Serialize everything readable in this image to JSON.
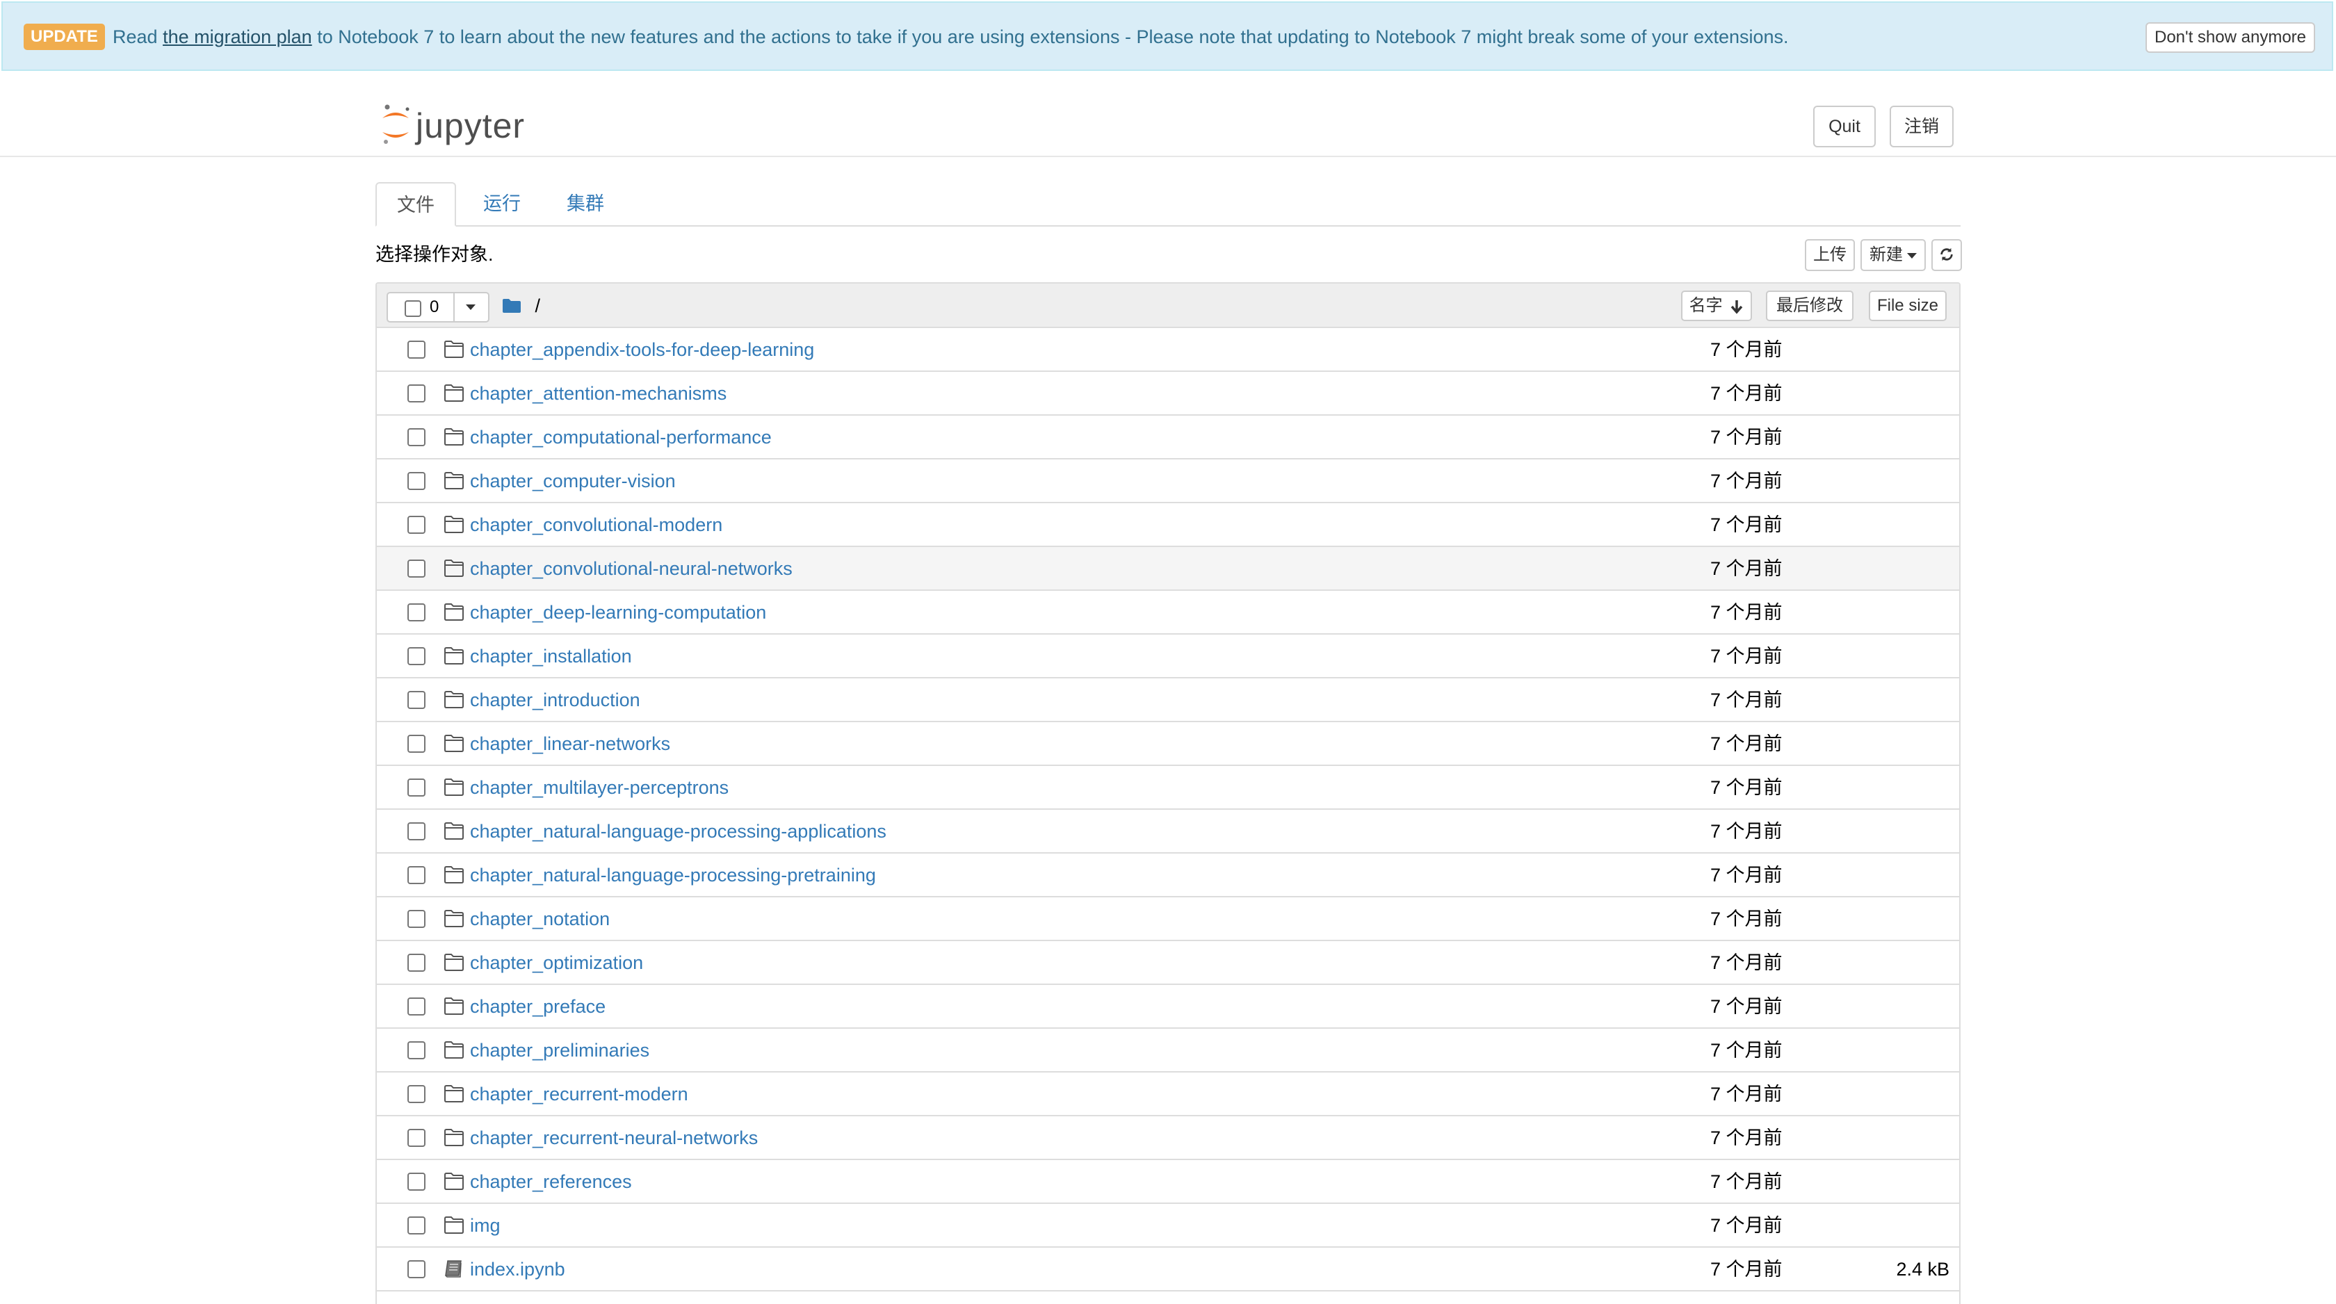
{
  "banner": {
    "badge": "UPDATE",
    "text_before": "Read ",
    "link": "the migration plan",
    "text_after": " to Notebook 7 to learn about the new features and the actions to take if you are using extensions - Please note that updating to Notebook 7 might break some of your extensions.",
    "dismiss_label": "Don't show anymore"
  },
  "header": {
    "logo_text": "jupyter",
    "quit_label": "Quit",
    "logout_label": "注销"
  },
  "tabs": [
    {
      "label": "文件",
      "active": true
    },
    {
      "label": "运行",
      "active": false
    },
    {
      "label": "集群",
      "active": false
    }
  ],
  "toolbar": {
    "select_hint": "选择操作对象.",
    "upload_label": "上传",
    "new_label": "新建",
    "refresh_icon": "refresh-icon"
  },
  "list_header": {
    "selected_count": "0",
    "breadcrumb": "/",
    "sort_name_label": "名字",
    "sort_modified_label": "最后修改",
    "sort_size_label": "File size"
  },
  "items": [
    {
      "name": "chapter_appendix-tools-for-deep-learning",
      "type": "folder",
      "modified": "7 个月前",
      "size": ""
    },
    {
      "name": "chapter_attention-mechanisms",
      "type": "folder",
      "modified": "7 个月前",
      "size": ""
    },
    {
      "name": "chapter_computational-performance",
      "type": "folder",
      "modified": "7 个月前",
      "size": ""
    },
    {
      "name": "chapter_computer-vision",
      "type": "folder",
      "modified": "7 个月前",
      "size": ""
    },
    {
      "name": "chapter_convolutional-modern",
      "type": "folder",
      "modified": "7 个月前",
      "size": ""
    },
    {
      "name": "chapter_convolutional-neural-networks",
      "type": "folder",
      "modified": "7 个月前",
      "size": ""
    },
    {
      "name": "chapter_deep-learning-computation",
      "type": "folder",
      "modified": "7 个月前",
      "size": ""
    },
    {
      "name": "chapter_installation",
      "type": "folder",
      "modified": "7 个月前",
      "size": ""
    },
    {
      "name": "chapter_introduction",
      "type": "folder",
      "modified": "7 个月前",
      "size": ""
    },
    {
      "name": "chapter_linear-networks",
      "type": "folder",
      "modified": "7 个月前",
      "size": ""
    },
    {
      "name": "chapter_multilayer-perceptrons",
      "type": "folder",
      "modified": "7 个月前",
      "size": ""
    },
    {
      "name": "chapter_natural-language-processing-applications",
      "type": "folder",
      "modified": "7 个月前",
      "size": ""
    },
    {
      "name": "chapter_natural-language-processing-pretraining",
      "type": "folder",
      "modified": "7 个月前",
      "size": ""
    },
    {
      "name": "chapter_notation",
      "type": "folder",
      "modified": "7 个月前",
      "size": ""
    },
    {
      "name": "chapter_optimization",
      "type": "folder",
      "modified": "7 个月前",
      "size": ""
    },
    {
      "name": "chapter_preface",
      "type": "folder",
      "modified": "7 个月前",
      "size": ""
    },
    {
      "name": "chapter_preliminaries",
      "type": "folder",
      "modified": "7 个月前",
      "size": ""
    },
    {
      "name": "chapter_recurrent-modern",
      "type": "folder",
      "modified": "7 个月前",
      "size": ""
    },
    {
      "name": "chapter_recurrent-neural-networks",
      "type": "folder",
      "modified": "7 个月前",
      "size": ""
    },
    {
      "name": "chapter_references",
      "type": "folder",
      "modified": "7 个月前",
      "size": ""
    },
    {
      "name": "img",
      "type": "folder",
      "modified": "7 个月前",
      "size": ""
    },
    {
      "name": "index.ipynb",
      "type": "notebook",
      "modified": "7 个月前",
      "size": "2.4 kB"
    }
  ],
  "colors": {
    "link": "#337ab7",
    "banner_bg": "#d9edf7",
    "badge": "#f0ad4e",
    "jupyter_orange": "#f37726"
  }
}
